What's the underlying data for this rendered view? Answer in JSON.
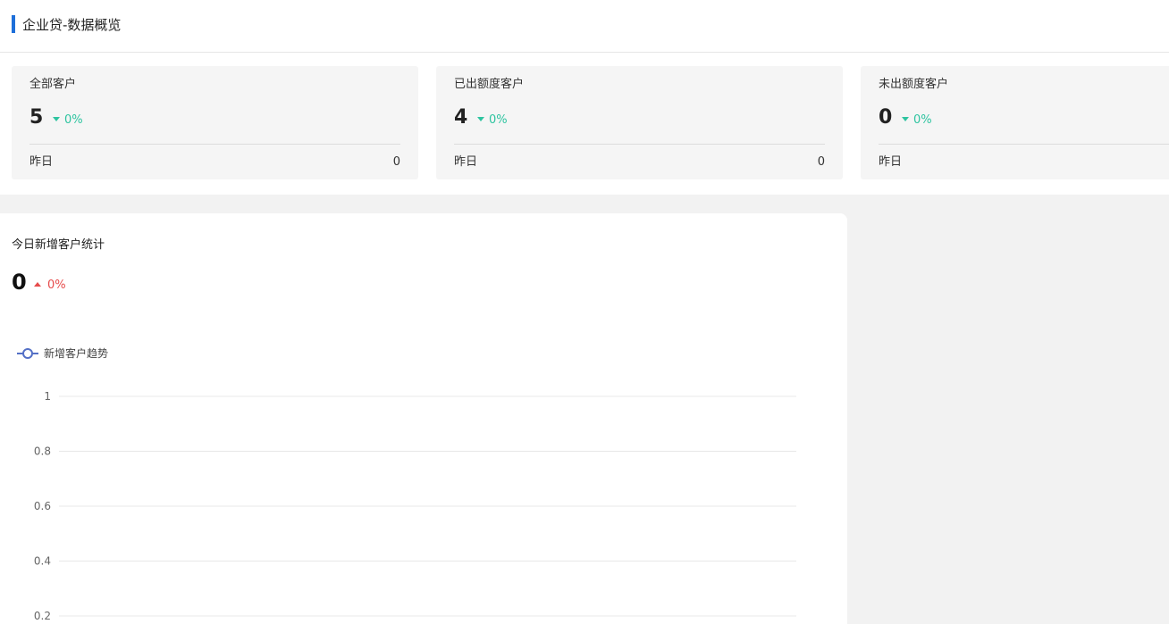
{
  "header": {
    "title": "企业贷-数据概览"
  },
  "cards": [
    {
      "label": "全部客户",
      "value": "5",
      "change": "0%",
      "foot_label": "昨日",
      "foot_value": "0"
    },
    {
      "label": "已出额度客户",
      "value": "4",
      "change": "0%",
      "foot_label": "昨日",
      "foot_value": "0"
    },
    {
      "label": "未出额度客户",
      "value": "0",
      "change": "0%",
      "foot_label": "昨日",
      "foot_value": ""
    }
  ],
  "panel": {
    "title": "今日新增客户统计",
    "value": "0",
    "change": "0%"
  },
  "colors": {
    "accent": "#1e6fd9",
    "down": "#2ec4a0",
    "up": "#e64b4b",
    "series": "#5470c6"
  },
  "chart_data": {
    "type": "line",
    "series": [
      {
        "name": "新增客户趋势",
        "values": []
      }
    ],
    "yticks": [
      "1",
      "0.8",
      "0.6",
      "0.4",
      "0.2"
    ],
    "ylim": [
      0,
      1
    ],
    "legend": "top-left",
    "grid": true
  }
}
